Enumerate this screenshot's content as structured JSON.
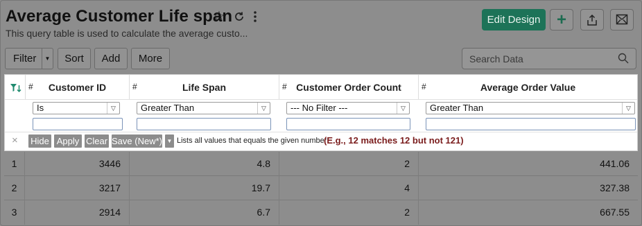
{
  "header": {
    "title": "Average Customer Life span",
    "subtitle": "This query table is used to calculate the average custo...",
    "edit_design_label": "Edit Design",
    "add_label": "+"
  },
  "toolbar": {
    "filter_label": "Filter",
    "sort_label": "Sort",
    "add_label": "Add",
    "more_label": "More",
    "search_placeholder": "Search Data"
  },
  "columns": [
    {
      "hash": "#",
      "label": "Customer ID"
    },
    {
      "hash": "#",
      "label": "Life Span"
    },
    {
      "hash": "#",
      "label": "Customer Order Count"
    },
    {
      "hash": "#",
      "label": "Average Order Value"
    }
  ],
  "filters": [
    {
      "operator": "Is",
      "value": ""
    },
    {
      "operator": "Greater Than",
      "value": ""
    },
    {
      "operator": "--- No Filter ---",
      "value": ""
    },
    {
      "operator": "Greater Than",
      "value": ""
    }
  ],
  "filter_actions": {
    "close": "×",
    "hide": "Hide",
    "apply": "Apply",
    "clear": "Clear",
    "save": "Save (New*)",
    "hint": "Lists all values that equals the given number",
    "example": "(E.g., 12 matches 12 but not 121)"
  },
  "rows": [
    {
      "index": "1",
      "customer_id": "3446",
      "life_span": "4.8",
      "order_count": "2",
      "avg_order_value": "441.06"
    },
    {
      "index": "2",
      "customer_id": "3217",
      "life_span": "19.7",
      "order_count": "4",
      "avg_order_value": "327.38"
    },
    {
      "index": "3",
      "customer_id": "2914",
      "life_span": "6.7",
      "order_count": "2",
      "avg_order_value": "667.55"
    }
  ],
  "colors": {
    "primary_button": "#1d7358",
    "example_text": "#7a1c1c",
    "filter_icon": "#1f8a6e"
  }
}
